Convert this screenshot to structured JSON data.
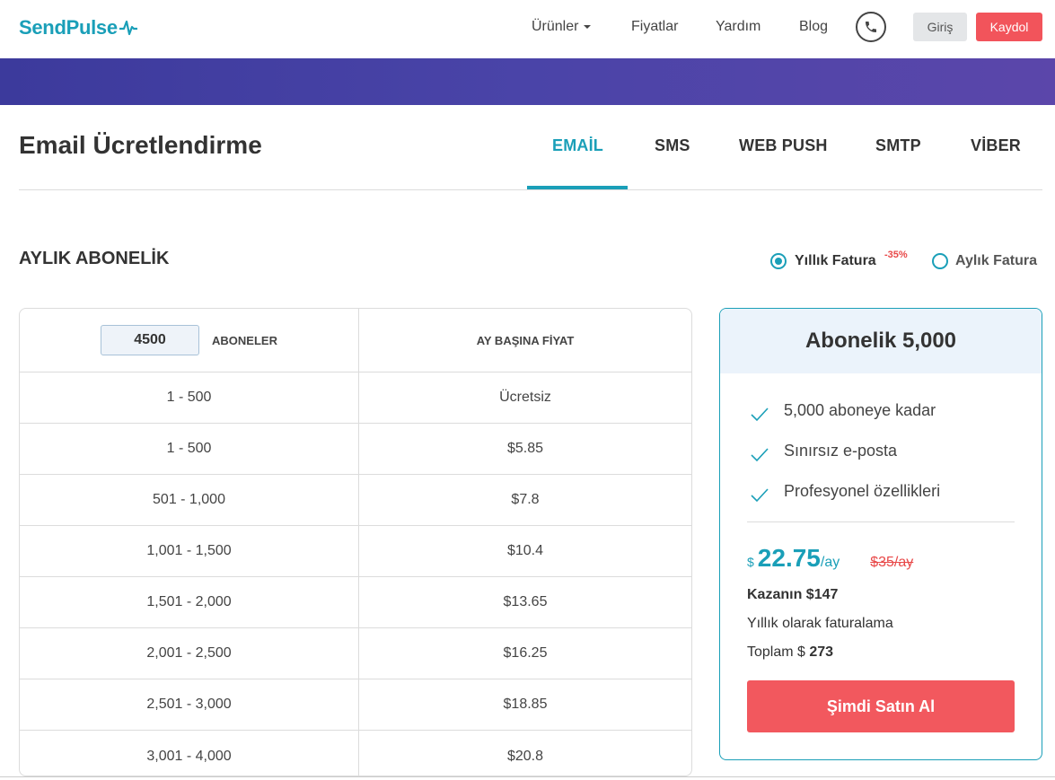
{
  "brand": {
    "name": "SendPulse",
    "accent": "#1a9fb8"
  },
  "nav": {
    "items": [
      {
        "label": "Ürünler",
        "has_caret": true
      },
      {
        "label": "Fiyatlar"
      },
      {
        "label": "Yardım"
      },
      {
        "label": "Blog"
      }
    ],
    "phone_icon": "phone-icon",
    "login_label": "Giriş",
    "signup_label": "Kaydol"
  },
  "page": {
    "title": "Email Ücretlendirme",
    "tabs": [
      {
        "label": "EMAİL",
        "active": true
      },
      {
        "label": "SMS"
      },
      {
        "label": "WEB PUSH"
      },
      {
        "label": "SMTP"
      },
      {
        "label": "VİBER"
      }
    ]
  },
  "subscription": {
    "section_title": "AYLIK ABONELİK",
    "billing_options": [
      {
        "label": "Yıllık Fatura",
        "badge": "-35%",
        "selected": true
      },
      {
        "label": "Aylık Fatura",
        "selected": false
      }
    ]
  },
  "table": {
    "subscribers_value": "4500",
    "subscribers_label": "ABONELER",
    "price_header": "AY BAŞINA FİYAT",
    "rows": [
      {
        "range": "1 - 500",
        "price": "Ücretsiz"
      },
      {
        "range": "1 - 500",
        "price": "$5.85"
      },
      {
        "range": "501 - 1,000",
        "price": "$7.8"
      },
      {
        "range": "1,001 - 1,500",
        "price": "$10.4"
      },
      {
        "range": "1,501 - 2,000",
        "price": "$13.65"
      },
      {
        "range": "2,001 - 2,500",
        "price": "$16.25"
      },
      {
        "range": "2,501 - 3,000",
        "price": "$18.85"
      },
      {
        "range": "3,001 - 4,000",
        "price": "$20.8"
      }
    ]
  },
  "plan": {
    "title": "Abonelik 5,000",
    "features": [
      "5,000 aboneye kadar",
      "Sınırsız e-posta",
      "Profesyonel özellikleri"
    ],
    "currency": "$",
    "price": "22.75",
    "per": "/ay",
    "old_price": "$35/ay",
    "savings": "Kazanın $147",
    "billing_note": "Yıllık olarak faturalama",
    "total_label": "Toplam $",
    "total_value": "273",
    "buy_label": "Şimdi Satın Al"
  }
}
